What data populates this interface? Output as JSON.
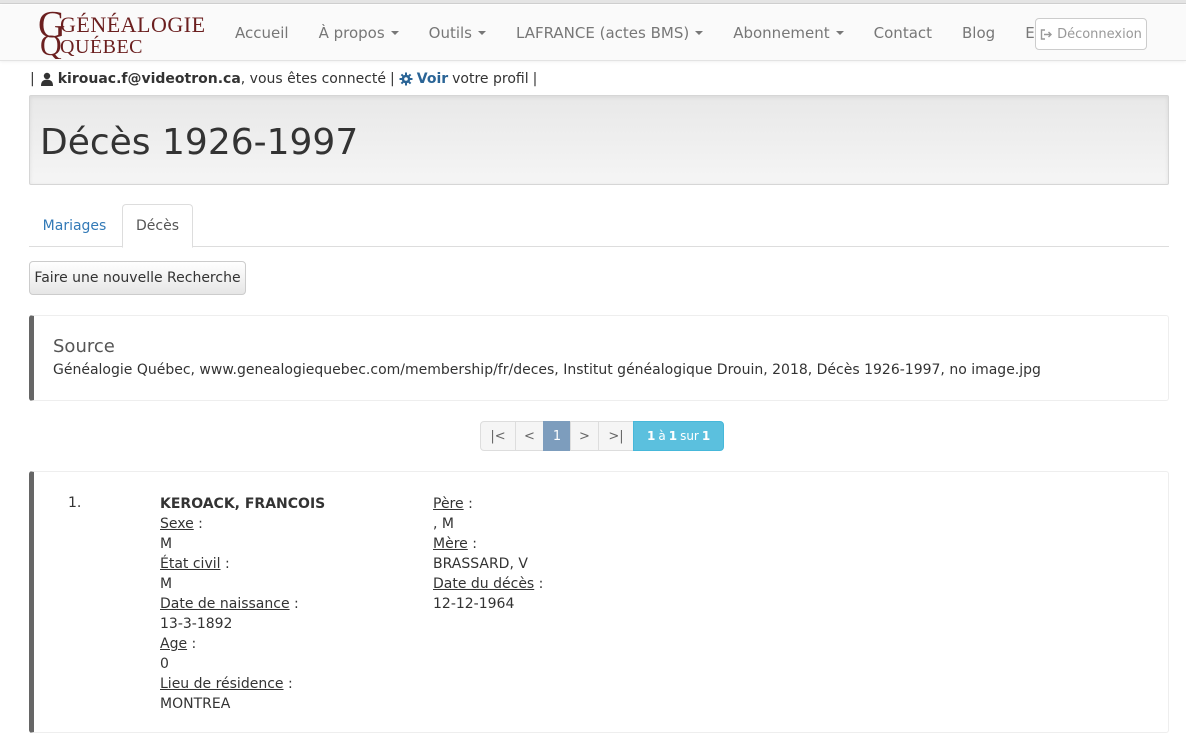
{
  "nav": {
    "logo": {
      "line1": "GÉNÉALOGIE",
      "line2": "QUÉBEC"
    },
    "items": [
      {
        "label": "Accueil",
        "dropdown": false
      },
      {
        "label": "À propos",
        "dropdown": true
      },
      {
        "label": "Outils",
        "dropdown": true
      },
      {
        "label": "LAFRANCE (actes BMS)",
        "dropdown": true
      },
      {
        "label": "Abonnement",
        "dropdown": true
      },
      {
        "label": "Contact",
        "dropdown": false
      },
      {
        "label": "Blog",
        "dropdown": false
      },
      {
        "label": "English",
        "dropdown": false
      }
    ],
    "logout_label": "Déconnexion"
  },
  "userbar": {
    "email": "kirouac.f@videotron.ca",
    "connected_text": ", vous êtes connecté",
    "voir_label": "Voir",
    "profile_text": "votre profil",
    "separator": "|"
  },
  "page": {
    "title": "Décès 1926-1997"
  },
  "tabs": [
    {
      "label": "Mariages",
      "active": false
    },
    {
      "label": "Décès",
      "active": true
    }
  ],
  "new_search_label": "Faire une nouvelle Recherche",
  "source": {
    "heading": "Source",
    "text": "Généalogie Québec, www.genealogiequebec.com/membership/fr/deces, Institut généalogique Drouin, 2018, Décès 1926-1997, no image.jpg"
  },
  "pagination": {
    "first": "|<",
    "prev": "<",
    "current": "1",
    "next": ">",
    "last": ">|",
    "info_from": "1",
    "info_a": "à",
    "info_to": "1",
    "info_sur": "sur",
    "info_total": "1"
  },
  "record": {
    "number": "1.",
    "name": "KEROACK, FRANCOIS",
    "sexe_label": "Sexe",
    "sexe_value": "M",
    "etat_civil_label": "État civil",
    "etat_civil_value": "M",
    "naissance_label": "Date de naissance",
    "naissance_value": "13-3-1892",
    "age_label": "Age",
    "age_value": "0",
    "residence_label": "Lieu de résidence",
    "residence_value": "MONTREA",
    "pere_label": "Père",
    "pere_value": ", M",
    "mere_label": "Mère",
    "mere_value": "BRASSARD, V",
    "deces_label": "Date du décès",
    "deces_value": "12-12-1964"
  },
  "colors": {
    "brand": "#6b1f1f",
    "link": "#337ab7",
    "info": "#5bc0de",
    "active_page": "#7d9dbd"
  }
}
